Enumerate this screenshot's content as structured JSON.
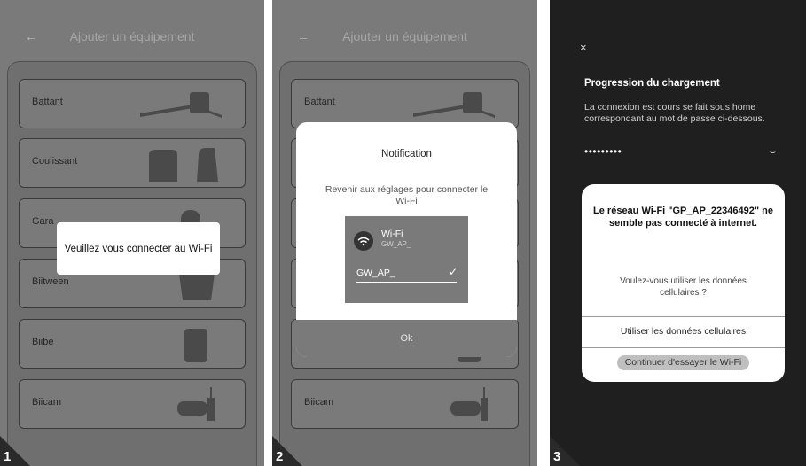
{
  "screen1": {
    "step": "1",
    "back_icon": "←",
    "header_title": "Ajouter un équipement",
    "devices": [
      "Battant",
      "Coulissant",
      "Gara",
      "Biitween",
      "Biibe",
      "Biicam"
    ],
    "toast": "Veuillez vous connecter au Wi-Fi"
  },
  "screen2": {
    "step": "2",
    "back_icon": "←",
    "header_title": "Ajouter un équipement",
    "devices": [
      "Battant",
      "Biicam"
    ],
    "dialog": {
      "title": "Notification",
      "message": "Revenir aux réglages pour connecter le Wi-Fi",
      "wifi_label": "Wi-Fi",
      "wifi_sub": "GW_AP_",
      "network_field": "GW_AP_",
      "check_icon": "✓",
      "ok": "Ok"
    }
  },
  "screen3": {
    "step": "3",
    "close_icon": "×",
    "title": "Progression du chargement",
    "description": "La connexion est cours se fait sous home correspondant au mot de passe ci-dessous.",
    "password": "•••••••••",
    "eye_icon": "⌣",
    "dialog": {
      "title": "Le réseau Wi-Fi \"GP_AP_22346492\" ne semble pas connecté à internet.",
      "question": "Voulez-vous utiliser les données cellulaires ?",
      "option_cellular": "Utiliser les données cellulaires",
      "option_wifi": "Continuer d'essayer le Wi-Fi"
    }
  },
  "colors": {
    "overlay": "#7a7a7a",
    "dark": "#1f1f1f",
    "dialog": "#ffffff"
  }
}
